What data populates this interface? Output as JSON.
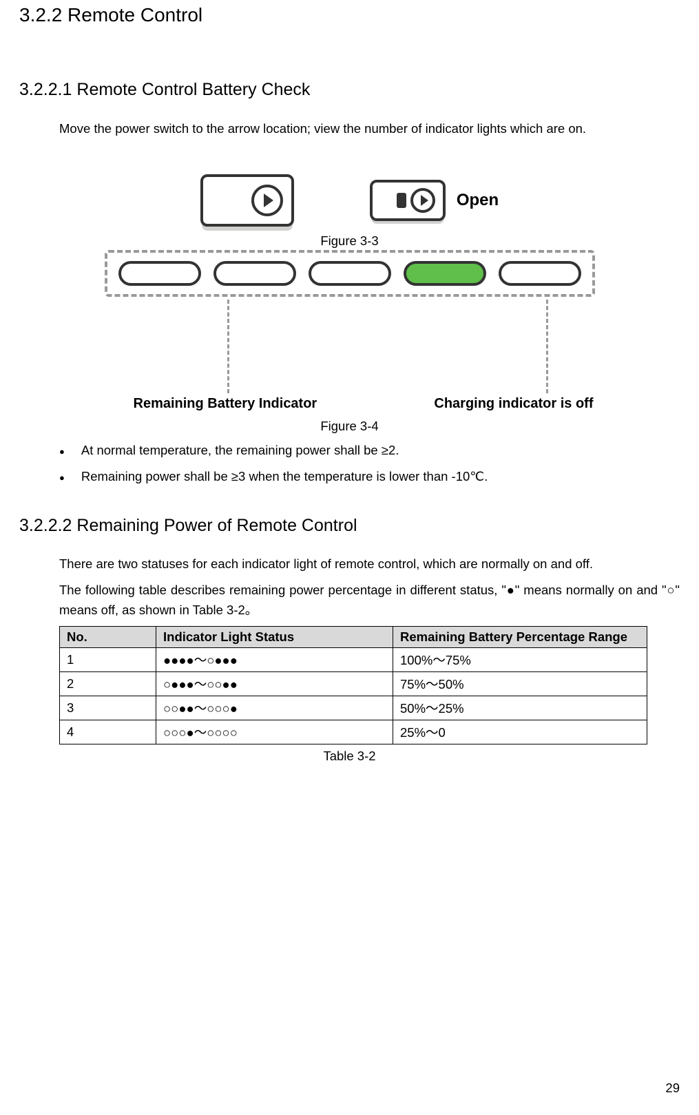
{
  "headings": {
    "h1": "3.2.2 Remote Control",
    "h2a": "3.2.2.1 Remote Control Battery Check",
    "h2b": "3.2.2.2 Remaining Power of Remote Control"
  },
  "paragraphs": {
    "p1": "Move the power switch to the arrow location; view the number of indicator lights which are on.",
    "p2": "There are two statuses for each indicator light of remote control, which are normally on and off.",
    "p3": "The following table describes remaining power percentage in different status, \"●\" means normally on and \"○\" means off, as shown in Table 3-2。"
  },
  "captions": {
    "fig33": "Figure 3-3",
    "fig34": "Figure 3-4",
    "table": "Table 3-2"
  },
  "fig34labels": {
    "left": "Remaining Battery Indicator",
    "right": "Charging indicator is off",
    "open": "Open"
  },
  "bullets": [
    "At normal temperature, the remaining power shall be ≥2.",
    "Remaining power shall be ≥3 when the temperature is lower than -10℃."
  ],
  "table": {
    "headers": [
      "No.",
      "Indicator Light Status",
      "Remaining Battery Percentage Range"
    ],
    "rows": [
      [
        "1",
        "●●●●～○●●●",
        "100%～75%"
      ],
      [
        "2",
        "○●●●～○○●●",
        "75%～50%"
      ],
      [
        "3",
        "○○●●～○○○●",
        "50%～25%"
      ],
      [
        "4",
        "○○○●～○○○○",
        "25%～0"
      ]
    ]
  },
  "page_number": "29"
}
